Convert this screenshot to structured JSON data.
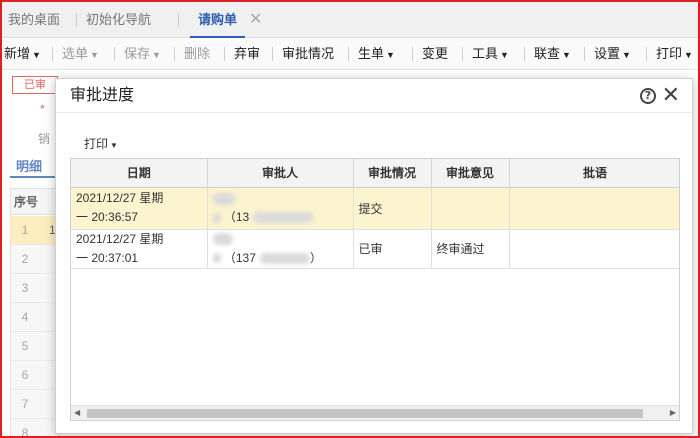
{
  "tabs": {
    "desktop": "我的桌面",
    "nav": "初始化导航",
    "active": "请购单",
    "close_glyph": "✕"
  },
  "toolbar": {
    "new": "新增",
    "select": "选单",
    "save": "保存",
    "delete": "删除",
    "abandon": "弃审",
    "approval_status": "审批情况",
    "generate": "生单",
    "change": "变更",
    "tools": "工具",
    "linked_query": "联查",
    "settings": "设置",
    "print": "打印"
  },
  "background": {
    "status_tag": "已审",
    "required_mark": "*",
    "sales_label": "销",
    "detail_tab": "明细",
    "grid_header": "序号",
    "grid_rows": [
      "1",
      "2",
      "3",
      "4",
      "5",
      "6",
      "7",
      "8"
    ],
    "grid_first_row_col2": "1"
  },
  "modal": {
    "title": "审批进度",
    "print_label": "打印",
    "columns": [
      "日期",
      "审批人",
      "审批情况",
      "审批意见",
      "批语"
    ],
    "rows": [
      {
        "date_line1": "2021/12/27 星期",
        "date_line2": "一 20:36:57",
        "approver_line1": "",
        "approver_line2": "（13",
        "status": "提交",
        "opinion": "",
        "comment": ""
      },
      {
        "date_line1": "2021/12/27 星期",
        "date_line2": "一 20:37:01",
        "approver_line1": "",
        "approver_line2": "（137",
        "approver_line2_end": "）",
        "status": "已审",
        "opinion": "终审通过",
        "comment": ""
      }
    ]
  },
  "colors": {
    "accent": "#2f5fb0",
    "selected_row": "#fcf3cf",
    "alert": "#e03030"
  }
}
